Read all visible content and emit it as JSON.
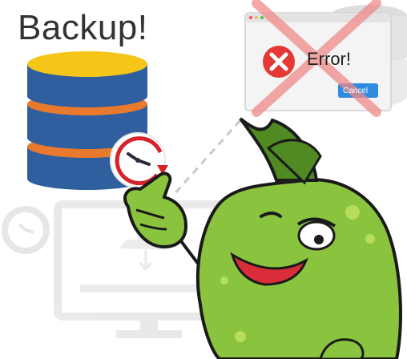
{
  "heading": "Backup!",
  "dialog": {
    "message": "Error!",
    "button_label": "Cancel"
  },
  "colors": {
    "db_yellow": "#f5c518",
    "db_blue": "#2f5f9e",
    "db_orange": "#e8792d",
    "clock_red": "#d6232a",
    "error_red": "#e53935",
    "cancel_blue": "#2f8be0",
    "mascot_green": "#8ac43f",
    "cross_pink": "#f08a8a"
  },
  "icons": [
    "database-icon",
    "clock-icon",
    "error-icon",
    "cancel-button",
    "computer-icon",
    "mascot"
  ]
}
